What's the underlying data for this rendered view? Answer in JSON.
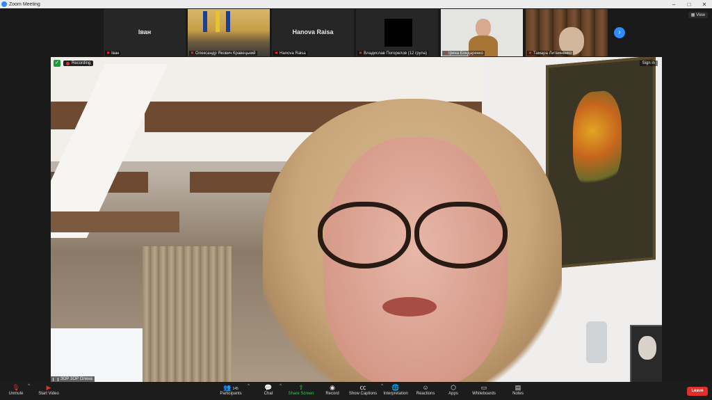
{
  "window": {
    "title": "Zoom Meeting"
  },
  "strip": {
    "view_label": "View",
    "thumbs": [
      {
        "name": "Іван",
        "label": "Іван",
        "type": "name"
      },
      {
        "name": "",
        "label": "Олександр Якович Кравецький",
        "type": "video"
      },
      {
        "name": "Hanova Raisa",
        "label": "Hanova Raisa",
        "type": "name"
      },
      {
        "name": "",
        "label": "Владислав Погорелов (12 група)",
        "type": "black"
      },
      {
        "name": "",
        "label": "Ірина Бондаренко",
        "type": "video"
      },
      {
        "name": "",
        "label": "Тамара Литвиненко",
        "type": "video"
      }
    ]
  },
  "main": {
    "recording_label": "Recording",
    "signin_label": "Sign in",
    "speaker_label": "ЗОР ЗОР Олена"
  },
  "toolbar": {
    "unmute": "Unmute",
    "start_video": "Start Video",
    "participants": "Participants",
    "participants_count": "145",
    "chat": "Chat",
    "share_screen": "Share Screen",
    "record": "Record",
    "show_captions": "Show Captions",
    "interpretation": "Interpretation",
    "reactions": "Reactions",
    "apps": "Apps",
    "whiteboards": "Whiteboards",
    "notes": "Notes",
    "leave": "Leave"
  },
  "colors": {
    "accent": "#2d8cff",
    "leave": "#e0302b",
    "share": "#2bd14b"
  }
}
